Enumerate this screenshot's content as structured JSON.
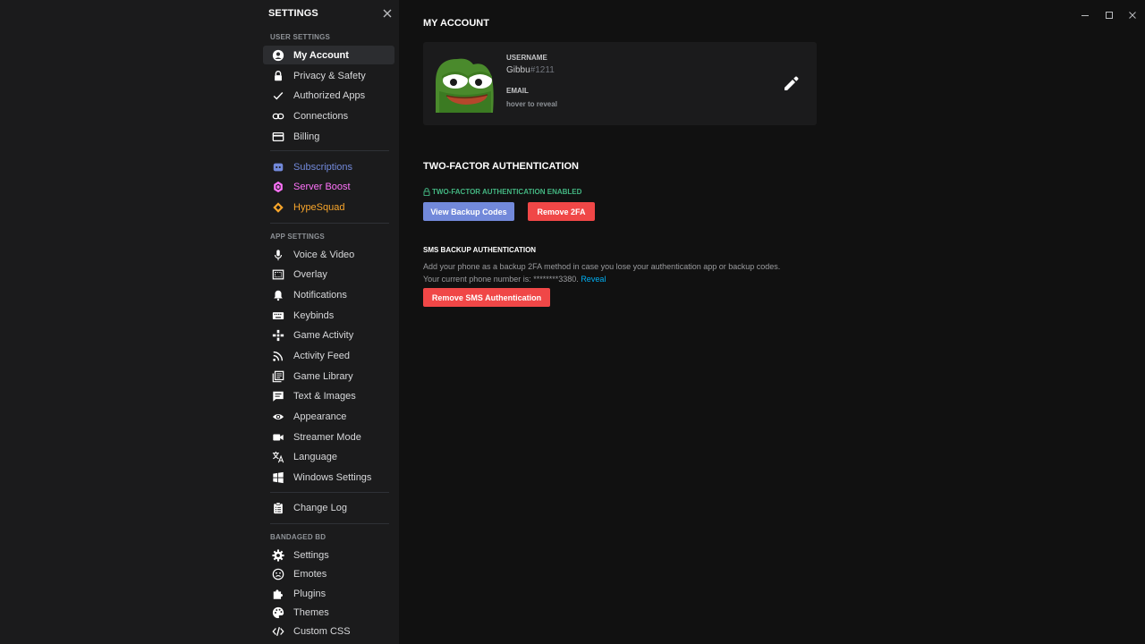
{
  "sidebar": {
    "title": "SETTINGS",
    "sections": {
      "user": "USER SETTINGS",
      "app": "APP SETTINGS",
      "bandaged": "BANDAGED BD"
    },
    "items": {
      "my_account": "My Account",
      "privacy": "Privacy & Safety",
      "authorized_apps": "Authorized Apps",
      "connections": "Connections",
      "billing": "Billing",
      "subscriptions": "Subscriptions",
      "server_boost": "Server Boost",
      "hypesquad": "HypeSquad",
      "voice_video": "Voice & Video",
      "overlay": "Overlay",
      "notifications": "Notifications",
      "keybinds": "Keybinds",
      "game_activity": "Game Activity",
      "activity_feed": "Activity Feed",
      "game_library": "Game Library",
      "text_images": "Text & Images",
      "appearance": "Appearance",
      "streamer_mode": "Streamer Mode",
      "language": "Language",
      "windows_settings": "Windows Settings",
      "change_log": "Change Log",
      "bd_settings": "Settings",
      "emotes": "Emotes",
      "plugins": "Plugins",
      "themes": "Themes",
      "custom_css": "Custom CSS"
    },
    "colors": {
      "subscriptions": "#7289da",
      "server_boost": "#ff73fa",
      "hypesquad": "#f9a62b"
    }
  },
  "main": {
    "title": "MY ACCOUNT",
    "account": {
      "username_label": "USERNAME",
      "username": "Gibbu",
      "discriminator": "#1211",
      "email_label": "EMAIL",
      "email_value": "hover to reveal",
      "edit_icon": "pencil-icon"
    },
    "two_factor": {
      "title": "TWO-FACTOR AUTHENTICATION",
      "enabled_text": "TWO-FACTOR AUTHENTICATION ENABLED",
      "view_backup_codes": "View Backup Codes",
      "remove_2fa": "Remove 2FA"
    },
    "sms": {
      "title": "SMS BACKUP AUTHENTICATION",
      "description": "Add your phone as a backup 2FA method in case you lose your authentication app or backup codes.",
      "phone_prefix": "Your current phone number is: ********3380.",
      "reveal": "Reveal",
      "remove_button": "Remove SMS Authentication"
    },
    "colors": {
      "accent": "#7289da",
      "danger": "#f04747",
      "success": "#43b581",
      "link": "#00b0f4"
    }
  },
  "window_controls": {
    "minimize": "minimize-icon",
    "maximize": "maximize-icon",
    "close": "close-icon"
  }
}
